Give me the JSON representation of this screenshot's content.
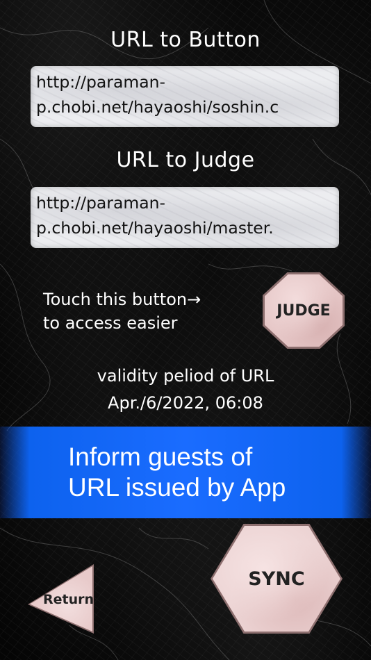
{
  "url_button": {
    "heading": "URL to Button",
    "line1": "http://paraman-",
    "line2": "p.chobi.net/hayaoshi/soshin.c"
  },
  "url_judge": {
    "heading": "URL to Judge",
    "line1": "http://paraman-",
    "line2": "p.chobi.net/hayaoshi/master."
  },
  "hint": {
    "line1": "Touch this button→",
    "line2": "to access easier"
  },
  "judge_button": {
    "label": "JUDGE"
  },
  "validity": {
    "label": "validity peliod of URL",
    "date": "Apr./6/2022, 06:08"
  },
  "banner": {
    "line1": "Inform guests of",
    "line2": "URL issued by App",
    "color": "#1a6cff"
  },
  "sync_button": {
    "label": "SYNC"
  },
  "return_button": {
    "label": "Return"
  }
}
